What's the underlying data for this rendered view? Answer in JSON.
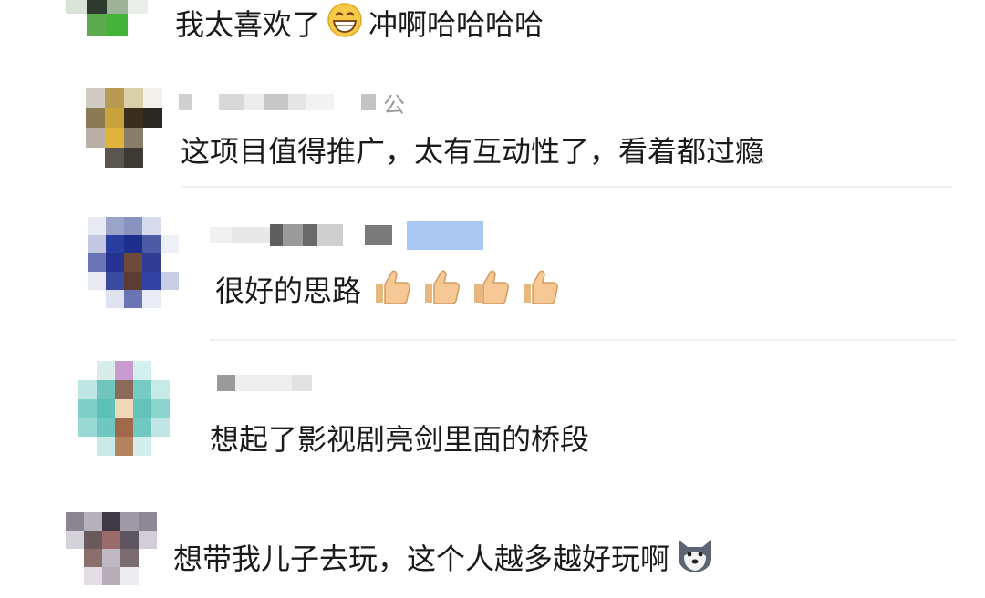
{
  "comments": [
    {
      "username": "",
      "text": "我太喜欢了",
      "text_after": "冲啊哈哈哈哈",
      "emoji": "grinning-face-icon"
    },
    {
      "username": "公",
      "text": "这项目值得推广，太有互动性了，看着都过瘾"
    },
    {
      "username": "",
      "text": "很好的思路",
      "emoji": "thumbs-up-icon",
      "emoji_count": 4
    },
    {
      "username": "",
      "text": "想起了影视剧亮剑里面的桥段"
    },
    {
      "username": "",
      "text": "想带我儿子去玩，这个人越多越好玩啊",
      "emoji": "husky-dog-icon"
    }
  ]
}
